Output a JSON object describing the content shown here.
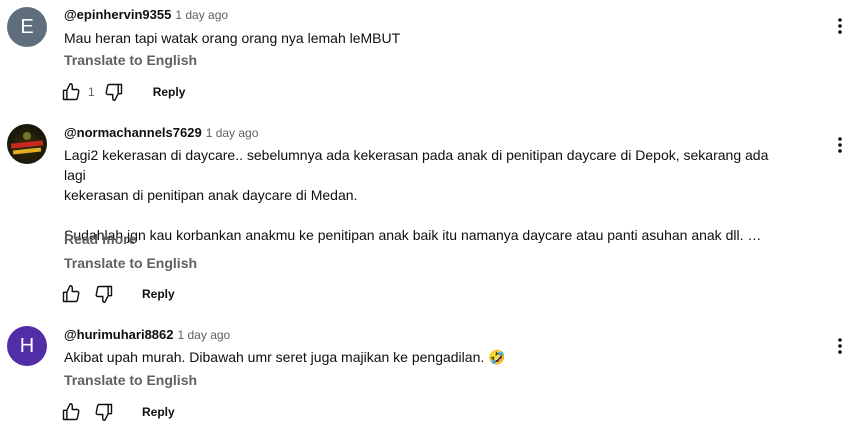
{
  "comments": [
    {
      "avatar_letter": "E",
      "avatar_color": "#5f6e7d",
      "handle": "@epinhervin9355",
      "time": "1 day ago",
      "text_lines": [
        "Mau heran tapi watak orang orang nya lemah leMBUT"
      ],
      "translate_label": "Translate to English",
      "like_count": "1",
      "reply_label": "Reply"
    },
    {
      "avatar_letter": "",
      "avatar_color": "#1c1a0a",
      "handle": "@normachannels7629",
      "time": "1 day ago",
      "text_lines": [
        "Lagi2 kekerasan di daycare.. sebelumnya ada kekerasan pada anak di penitipan daycare di Depok, sekarang ada lagi",
        "kekerasan di penitipan anak daycare di Medan.",
        "",
        "Sudahlah jgn kau korbankan anakmu ke penitipan anak baik itu namanya daycare atau panti asuhan anak dll. …"
      ],
      "read_more_label": "Read more",
      "translate_label": "Translate to English",
      "reply_label": "Reply"
    },
    {
      "avatar_letter": "H",
      "avatar_color": "#512da8",
      "handle": "@hurimuhari8862",
      "time": "1 day ago",
      "text_lines": [
        "Akibat upah murah. Dibawah umr seret juga majikan ke pengadilan. 🤣"
      ],
      "translate_label": "Translate to English",
      "reply_label": "Reply"
    }
  ],
  "icons": {
    "like": "thumbs-up-icon",
    "dislike": "thumbs-down-icon",
    "more": "more-vert-icon"
  }
}
